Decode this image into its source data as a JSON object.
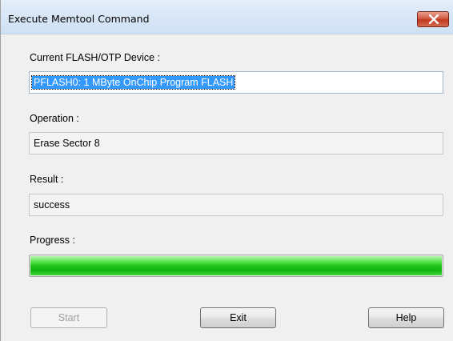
{
  "window": {
    "title": "Execute Memtool Command"
  },
  "device": {
    "label": "Current FLASH/OTP Device :",
    "value": "PFLASH0: 1 MByte OnChip Program FLASH"
  },
  "operation": {
    "label": "Operation :",
    "value": "Erase Sector 8"
  },
  "result": {
    "label": "Result :",
    "value": "success"
  },
  "progress": {
    "label": "Progress :",
    "percent": 100,
    "color": "#1ec21a"
  },
  "buttons": {
    "start": "Start",
    "exit": "Exit",
    "help": "Help"
  },
  "colors": {
    "selection": "#3399ff",
    "close_button": "#c0391f"
  }
}
